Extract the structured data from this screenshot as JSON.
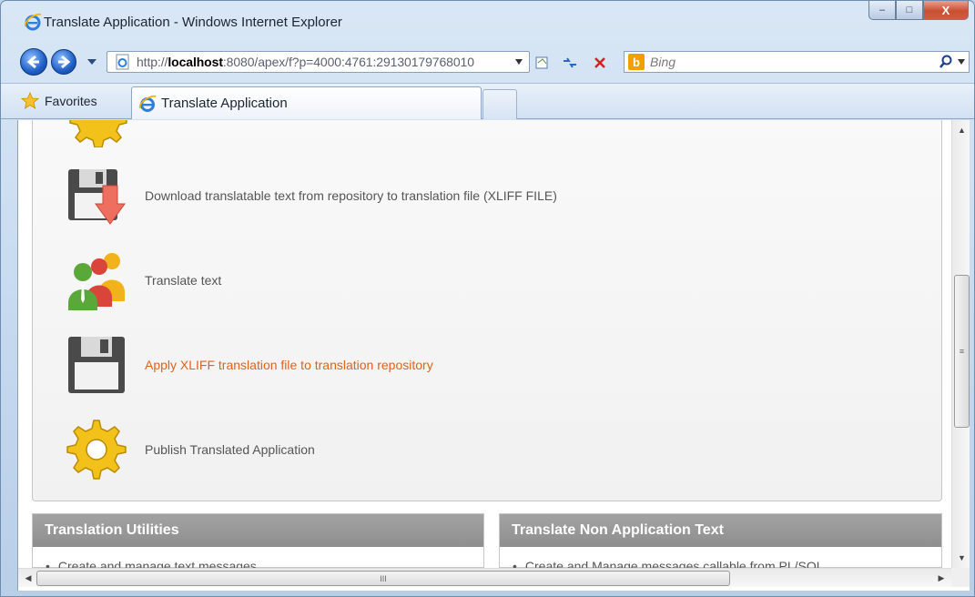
{
  "window": {
    "title": "Translate Application - Windows Internet Explorer",
    "controls": {
      "minimize": "–",
      "maximize": "□",
      "close": "X"
    }
  },
  "navigation": {
    "address_prefix": "http://",
    "address_host": "localhost",
    "address_rest": ":8080/apex/f?p=4000:4761:29130179768010",
    "search_placeholder": "Bing"
  },
  "favorites_bar": {
    "favorites_label": "Favorites",
    "tabs": [
      {
        "label": "Translate Application",
        "active": true
      }
    ]
  },
  "page": {
    "steps": [
      {
        "label": "Download translatable text from repository to translation file (XLIFF FILE)",
        "icon": "floppy-download-icon",
        "active": false
      },
      {
        "label": "Translate text",
        "icon": "people-group-icon",
        "active": false
      },
      {
        "label": "Apply XLIFF translation file to translation repository",
        "icon": "floppy-disk-icon",
        "active": true
      },
      {
        "label": "Publish Translated Application",
        "icon": "gear-icon",
        "active": false
      }
    ],
    "regions": [
      {
        "title": "Translation Utilities",
        "first_item": "Create and manage text messages"
      },
      {
        "title": "Translate Non Application Text",
        "first_item": "Create and Manage messages callable from PL/SQL"
      }
    ]
  },
  "scrollbars": {
    "vertical_grip": "≡",
    "horizontal_grip": "III"
  },
  "colors": {
    "active_link": "#e0621b",
    "region_header": "#9a9a9a",
    "ie_blue": "#1f5fc7"
  }
}
